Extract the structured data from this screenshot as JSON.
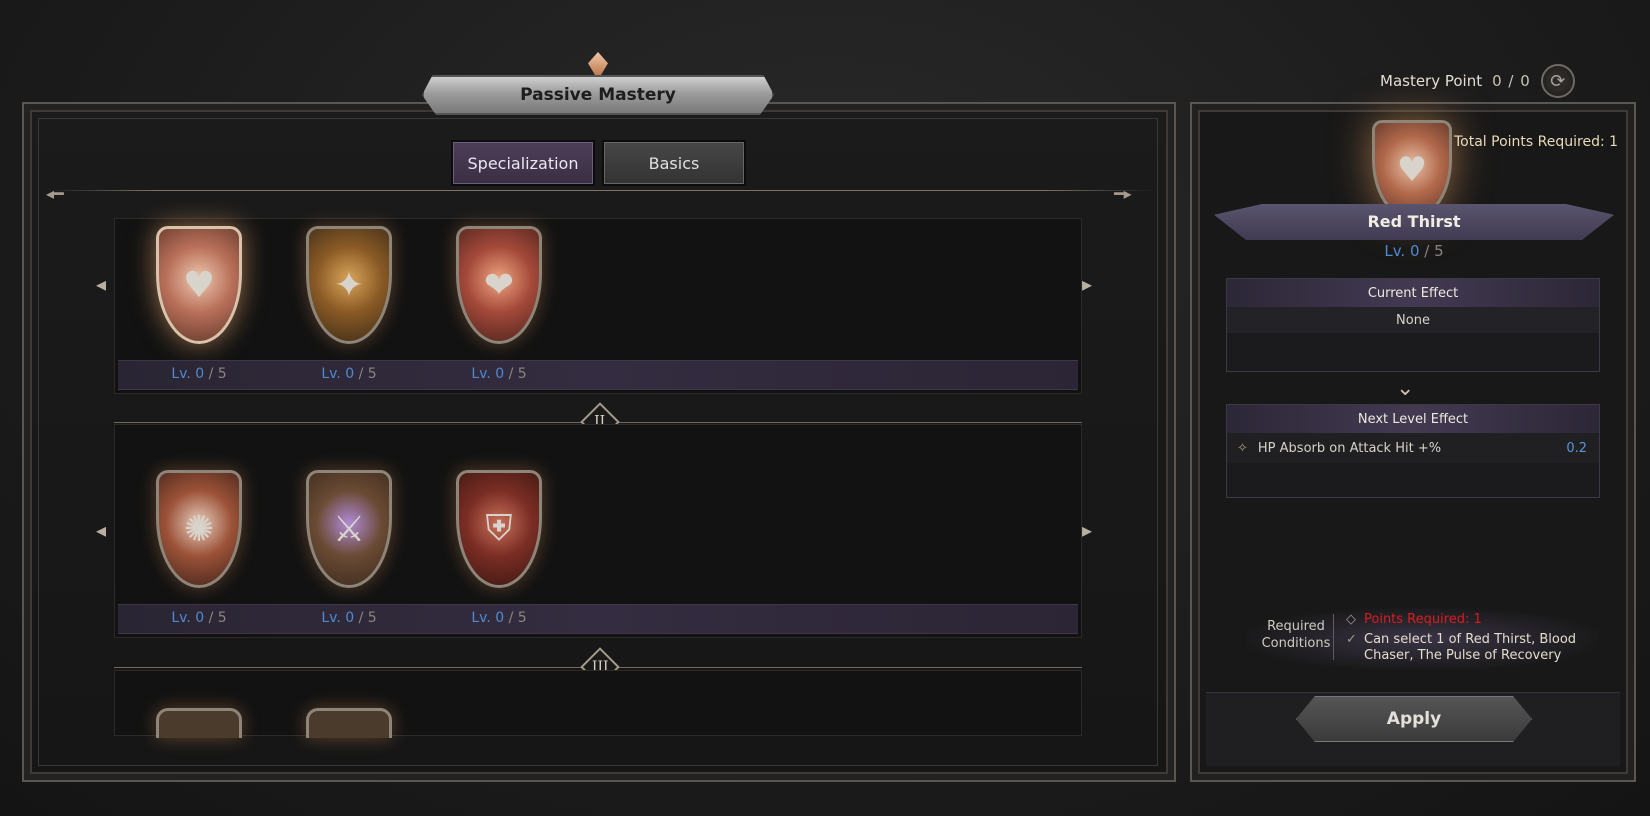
{
  "header": {
    "mastery_point_label": "Mastery Point",
    "mastery_point_value": "0  / 0"
  },
  "panel": {
    "title": "Passive Mastery",
    "tabs": [
      {
        "label": "Specialization",
        "active": true
      },
      {
        "label": "Basics",
        "active": false
      }
    ]
  },
  "rows": [
    {
      "roman": "",
      "skills": [
        {
          "icon": "red-thirst-icon",
          "glyph": "♥",
          "level": "Lv. 0",
          "max": "/ 5",
          "selected": true
        },
        {
          "icon": "blood-chaser-icon",
          "glyph": "✦",
          "level": "Lv. 0",
          "max": "/ 5",
          "selected": false
        },
        {
          "icon": "pulse-of-recovery-icon",
          "glyph": "❤",
          "level": "Lv. 0",
          "max": "/ 5",
          "selected": false
        }
      ]
    },
    {
      "roman": "II",
      "skills": [
        {
          "icon": "slash-orb-icon",
          "glyph": "✺",
          "level": "Lv. 0",
          "max": "/ 5",
          "selected": false
        },
        {
          "icon": "claw-strike-icon",
          "glyph": "⚔",
          "level": "Lv. 0",
          "max": "/ 5",
          "selected": false
        },
        {
          "icon": "blood-shield-icon",
          "glyph": "⛨",
          "level": "Lv. 0",
          "max": "/ 5",
          "selected": false
        }
      ]
    },
    {
      "roman": "III",
      "skills": []
    }
  ],
  "detail": {
    "total_points_required": "Total Points Required: 1",
    "skill_name": "Red Thirst",
    "skill_icon": "red-thirst-icon",
    "level": "Lv. 0",
    "max": "/ 5",
    "current_effect_title": "Current Effect",
    "current_effect_value": "None",
    "next_effect_title": "Next Level Effect",
    "next_effect_name": "HP Absorb on Attack Hit +%",
    "next_effect_value": "0.2",
    "required_label": "Required Conditions",
    "req_points": "Points Required: 1",
    "req_select": "Can select 1 of Red Thirst, Blood Chaser, The Pulse of Recovery",
    "apply_label": "Apply"
  },
  "colors": {
    "level_current": "#4f8ad0",
    "requirement_unmet": "#d81d1d",
    "effect_value": "#5697db"
  }
}
